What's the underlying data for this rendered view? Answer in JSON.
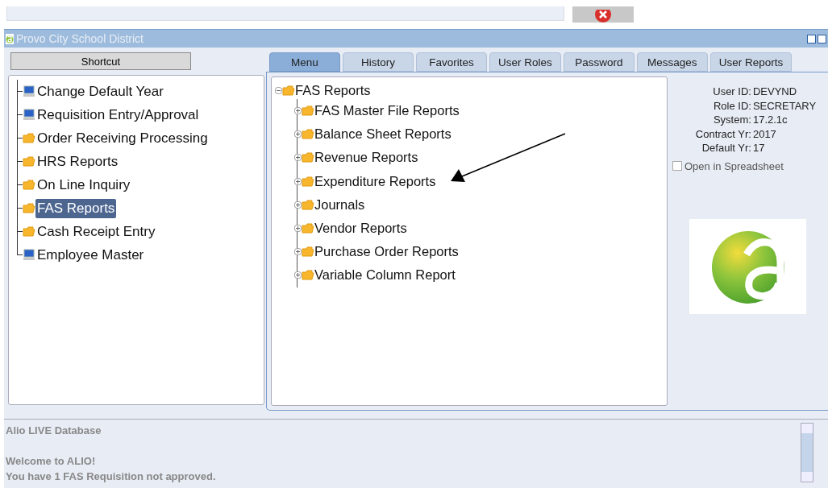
{
  "window": {
    "title": "Provo City School District"
  },
  "shortcut_button": "Shortcut",
  "shortcuts": [
    {
      "label": "Change Default Year",
      "kind": "program",
      "selected": false
    },
    {
      "label": "Requisition Entry/Approval",
      "kind": "program",
      "selected": false
    },
    {
      "label": "Order Receiving Processing",
      "kind": "folder",
      "selected": false
    },
    {
      "label": "HRS Reports",
      "kind": "folder",
      "selected": false
    },
    {
      "label": "On Line Inquiry",
      "kind": "folder",
      "selected": false
    },
    {
      "label": "FAS Reports",
      "kind": "folder",
      "selected": true
    },
    {
      "label": "Cash Receipt Entry",
      "kind": "folder",
      "selected": false
    },
    {
      "label": "Employee Master",
      "kind": "program",
      "selected": false
    }
  ],
  "tabs": [
    {
      "label": "Menu",
      "selected": true
    },
    {
      "label": "History",
      "selected": false
    },
    {
      "label": "Favorites",
      "selected": false
    },
    {
      "label": "User Roles",
      "selected": false
    },
    {
      "label": "Password",
      "selected": false
    },
    {
      "label": "Messages",
      "selected": false
    },
    {
      "label": "User Reports",
      "selected": false
    }
  ],
  "menu_tree": {
    "label": "FAS Reports",
    "expanded": true,
    "children": [
      {
        "label": "FAS Master File Reports",
        "expanded": false
      },
      {
        "label": "Balance Sheet Reports",
        "expanded": false
      },
      {
        "label": "Revenue Reports",
        "expanded": false
      },
      {
        "label": "Expenditure Reports",
        "expanded": false
      },
      {
        "label": "Journals",
        "expanded": false
      },
      {
        "label": "Vendor Reports",
        "expanded": false
      },
      {
        "label": "Purchase Order Reports",
        "expanded": false
      },
      {
        "label": "Variable Column Report",
        "expanded": false
      }
    ]
  },
  "user_info": [
    {
      "label": "User ID:",
      "value": "DEVYND"
    },
    {
      "label": "Role ID:",
      "value": "SECRETARY"
    },
    {
      "label": "System:",
      "value": "17.2.1c"
    },
    {
      "label": "Contract Yr:",
      "value": "2017"
    },
    {
      "label": "Default Yr:",
      "value": "17"
    }
  ],
  "open_in_spreadsheet": {
    "label": "Open in Spreadsheet",
    "checked": false
  },
  "messages": [
    {
      "lines": [
        "Alio LIVE Database"
      ]
    },
    {
      "lines": [
        "Welcome to ALIO!",
        "You have 1 FAS Requisition not approved."
      ]
    }
  ]
}
